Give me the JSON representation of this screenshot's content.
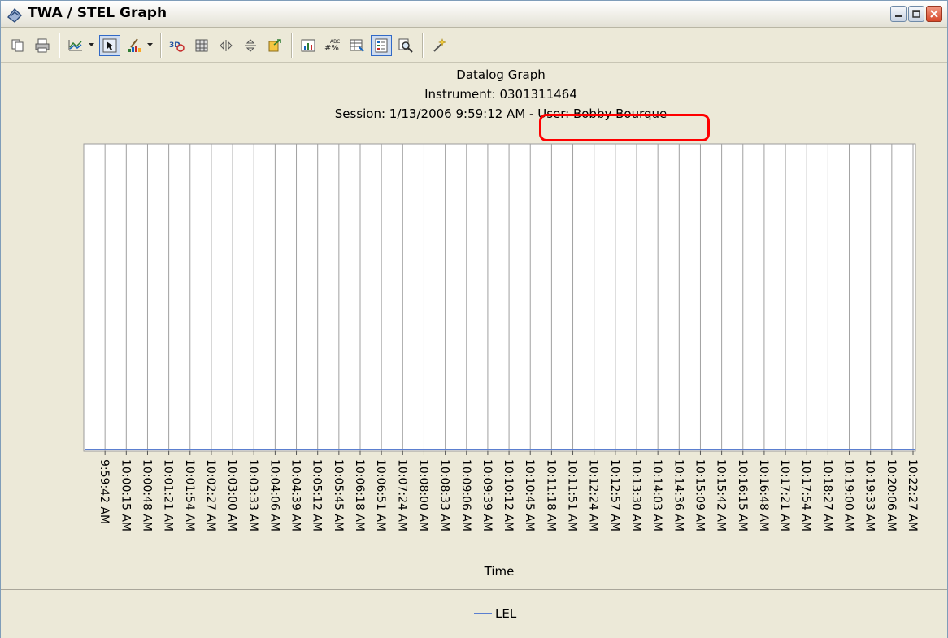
{
  "window": {
    "title": "TWA / STEL Graph"
  },
  "toolbar": {
    "buttons": [
      {
        "name": "copy-icon"
      },
      {
        "name": "print-icon"
      },
      {
        "name": "chart-type-icon"
      },
      {
        "name": "pointer-icon"
      },
      {
        "name": "palette-icon"
      },
      {
        "name": "3d-view-icon"
      },
      {
        "name": "grid-icon"
      },
      {
        "name": "rotate-horizontal-icon"
      },
      {
        "name": "rotate-vertical-icon"
      },
      {
        "name": "export-icon"
      },
      {
        "name": "chart-wizard-icon"
      },
      {
        "name": "data-labels-icon"
      },
      {
        "name": "data-grid-icon"
      },
      {
        "name": "legend-icon"
      },
      {
        "name": "zoom-icon"
      },
      {
        "name": "magic-wand-icon"
      }
    ]
  },
  "chart_data": {
    "type": "line",
    "title": "Datalog Graph",
    "subtitle_instrument": "Instrument: 0301311464",
    "subtitle_session": "Session: 1/13/2006 9:59:12 AM - User: Bobby Bourque",
    "xlabel": "Time",
    "ylabel": "",
    "grid": true,
    "legend_position": "bottom",
    "categories": [
      "9:59:42 AM",
      "10:00:15 AM",
      "10:00:48 AM",
      "10:01:21 AM",
      "10:01:54 AM",
      "10:02:27 AM",
      "10:03:00 AM",
      "10:03:33 AM",
      "10:04:06 AM",
      "10:04:39 AM",
      "10:05:12 AM",
      "10:05:45 AM",
      "10:06:18 AM",
      "10:06:51 AM",
      "10:07:24 AM",
      "10:08:00 AM",
      "10:08:33 AM",
      "10:09:06 AM",
      "10:09:39 AM",
      "10:10:12 AM",
      "10:10:45 AM",
      "10:11:18 AM",
      "10:11:51 AM",
      "10:12:24 AM",
      "10:12:57 AM",
      "10:13:30 AM",
      "10:14:03 AM",
      "10:14:36 AM",
      "10:15:09 AM",
      "10:15:42 AM",
      "10:16:15 AM",
      "10:16:48 AM",
      "10:17:21 AM",
      "10:17:54 AM",
      "10:18:27 AM",
      "10:19:00 AM",
      "10:19:33 AM",
      "10:20:06 AM",
      "10:22:27 AM"
    ],
    "series": [
      {
        "name": "LEL",
        "color": "#5b7fd0",
        "values": [
          0,
          0,
          0,
          0,
          0,
          0,
          0,
          0,
          0,
          0,
          0,
          0,
          0,
          0,
          0,
          0,
          0,
          0,
          0,
          0,
          0,
          0,
          0,
          0,
          0,
          0,
          0,
          0,
          0,
          0,
          0,
          0,
          0,
          0,
          0,
          0,
          0,
          0,
          0
        ]
      }
    ]
  }
}
